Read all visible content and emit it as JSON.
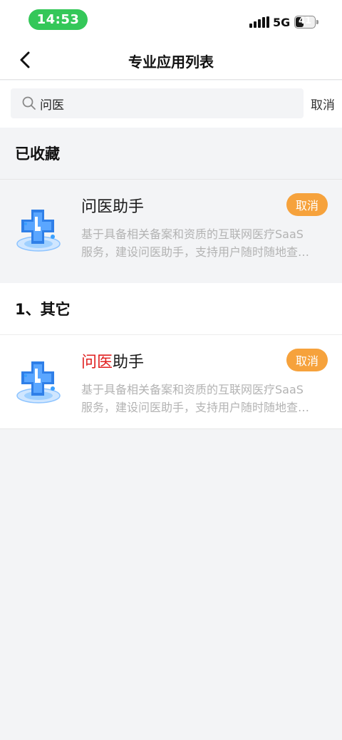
{
  "status_bar": {
    "time": "14:53",
    "network": "5G",
    "battery": "41",
    "battery_level": 0.41,
    "colors": {
      "time_pill": "#34c759"
    }
  },
  "nav": {
    "title": "专业应用列表",
    "back_icon": "chevron-left-icon"
  },
  "search": {
    "value": "问医",
    "icon": "search-icon",
    "cancel_label": "取消"
  },
  "favorites": {
    "header": "已收藏",
    "items": [
      {
        "name": "问医助手",
        "desc_line1": "基于具备相关备案和资质的互联网医疗SaaS",
        "desc_line2": "服务，建设问医助手，支持用户随时随地查…",
        "action_label": "取消"
      }
    ]
  },
  "others": {
    "header": "1、其它",
    "items": [
      {
        "name_highlight": "问医",
        "name_rest": "助手",
        "desc_line1": "基于具备相关备案和资质的互联网医疗SaaS",
        "desc_line2": "服务，建设问医助手，支持用户随时随地查…",
        "action_label": "取消"
      }
    ]
  },
  "colors": {
    "accent_orange": "#f6a23c",
    "highlight_red": "#e02020"
  }
}
